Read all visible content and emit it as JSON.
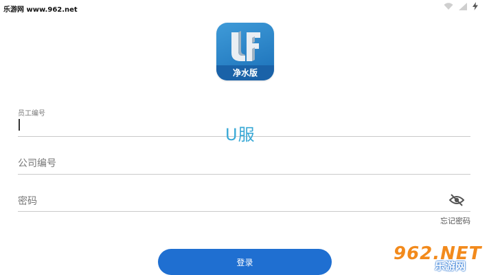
{
  "status_bar": {
    "watermark": "乐游网 www.962.net",
    "icons": [
      "wifi-icon",
      "signal-icon",
      "charging-icon"
    ]
  },
  "app": {
    "logo_subtitle": "净水版",
    "logo_letters": "UF"
  },
  "form": {
    "employee_id_label": "员工编号",
    "employee_id_value": "",
    "company_id_placeholder": "公司编号",
    "company_id_value": "",
    "password_placeholder": "密码",
    "password_value": "",
    "forgot_password": "忘记密码",
    "login_button": "登录"
  },
  "overlay": {
    "center_watermark": "U服",
    "corner_watermark_top": "962.NET",
    "corner_watermark_bottom": "乐游网"
  },
  "colors": {
    "accent": "#1f6fd1",
    "logo_blue": "#2b82c6",
    "watermark_orange": "#f28a1c"
  }
}
